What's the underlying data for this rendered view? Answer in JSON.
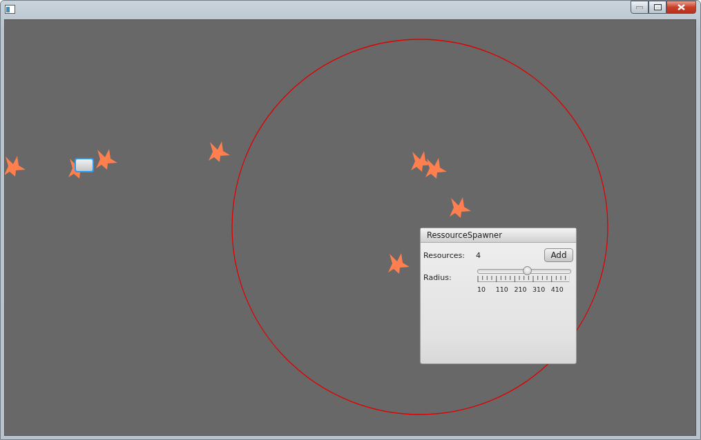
{
  "window": {
    "controls": [
      {
        "kind": "minimize"
      },
      {
        "kind": "maximize"
      },
      {
        "kind": "close"
      }
    ]
  },
  "panel": {
    "title": "RessourceSpawner",
    "resources_label": "Resources:",
    "resources_value": "4",
    "add_button": "Add",
    "radius_label": "Radius:",
    "radius_slider": {
      "level": 0.54,
      "tick_labels": [
        "10",
        "110",
        "210",
        "310",
        "410"
      ]
    }
  }
}
